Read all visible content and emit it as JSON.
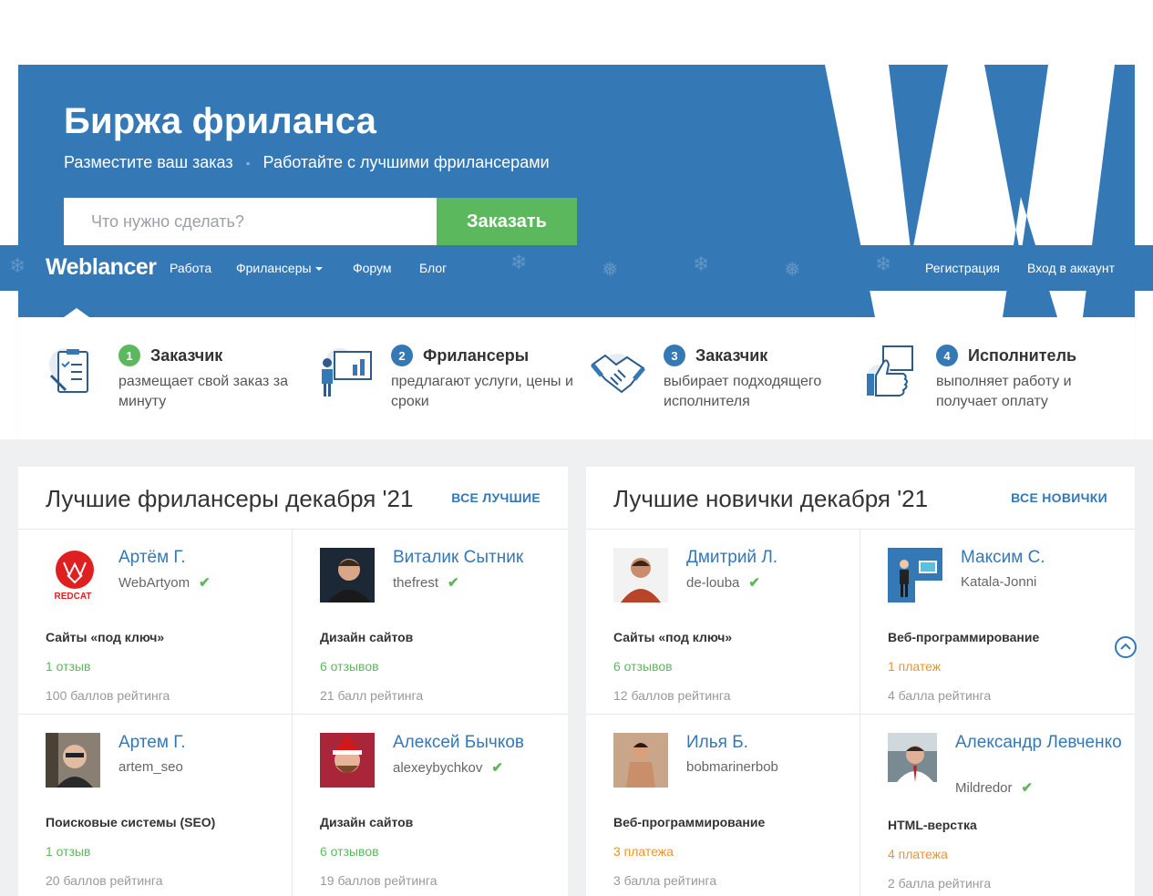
{
  "hero": {
    "title": "Биржа фриланса",
    "sub1": "Разместите ваш заказ",
    "sub2": "Работайте с лучшими фрилансерами",
    "search_placeholder": "Что нужно сделать?",
    "order_button": "Заказать",
    "bg_color": "#3478b6"
  },
  "nav": {
    "logo": "Weblancer",
    "items": [
      "Работа",
      "Фрилансеры",
      "Форум",
      "Блог"
    ],
    "register": "Регистрация",
    "login": "Вход в аккаунт"
  },
  "steps": [
    {
      "num": "1",
      "title": "Заказчик",
      "desc": "размещает свой заказ за минуту",
      "num_color": "#5cb85c",
      "icon": "clipboard-icon"
    },
    {
      "num": "2",
      "title": "Фрилансеры",
      "desc": "предлагают услуги, цены и сроки",
      "num_color": "#3478b6",
      "icon": "presentation-icon"
    },
    {
      "num": "3",
      "title": "Заказчик",
      "desc": "выбирает подходящего исполнителя",
      "num_color": "#3478b6",
      "icon": "handshake-icon"
    },
    {
      "num": "4",
      "title": "Исполнитель",
      "desc": "выполняет работу и получает оплату",
      "num_color": "#3478b6",
      "icon": "thumbs-up-icon"
    }
  ],
  "best": {
    "title": "Лучшие фрилансеры декабря '21",
    "link": "ВСЕ ЛУЧШИЕ",
    "cards": [
      {
        "name": "Артём Г.",
        "login": "WebArtyom",
        "verified": true,
        "category": "Сайты «под ключ»",
        "reviews": "1 отзыв",
        "reviews_color": "green",
        "rating": "100 баллов рейтинга"
      },
      {
        "name": "Виталик Сытник",
        "login": "thefrest",
        "verified": true,
        "category": "Дизайн сайтов",
        "reviews": "6 отзывов",
        "reviews_color": "green",
        "rating": "21 балл рейтинга"
      },
      {
        "name": "Артем Г.",
        "login": "artem_seo",
        "verified": false,
        "category": "Поисковые системы (SEO)",
        "reviews": "1 отзыв",
        "reviews_color": "green",
        "rating": "20 баллов рейтинга"
      },
      {
        "name": "Алексей Бычков",
        "login": "alexeybychkov",
        "verified": true,
        "category": "Дизайн сайтов",
        "reviews": "6 отзывов",
        "reviews_color": "green",
        "rating": "19 баллов рейтинга"
      }
    ]
  },
  "newbies": {
    "title": "Лучшие новички декабря '21",
    "link": "ВСЕ НОВИЧКИ",
    "cards": [
      {
        "name": "Дмитрий Л.",
        "login": "de-louba",
        "verified": true,
        "category": "Сайты «под ключ»",
        "reviews": "6 отзывов",
        "reviews_color": "green",
        "rating": "12 баллов рейтинга"
      },
      {
        "name": "Максим С.",
        "login": "Katala-Jonni",
        "verified": false,
        "category": "Веб-программирование",
        "reviews": "1 платеж",
        "reviews_color": "orange",
        "rating": "4 балла рейтинга"
      },
      {
        "name": "Илья Б.",
        "login": "bobmarinerbob",
        "verified": false,
        "category": "Веб-программирование",
        "reviews": "3 платежа",
        "reviews_color": "orange",
        "rating": "3 балла рейтинга"
      },
      {
        "name": "Александр Левченко",
        "login": "Mildredor",
        "verified": true,
        "category": "HTML-верстка",
        "reviews": "4 платежа",
        "reviews_color": "orange",
        "rating": "2 балла рейтинга"
      }
    ]
  },
  "avatar_logo_text": "REDCAT"
}
